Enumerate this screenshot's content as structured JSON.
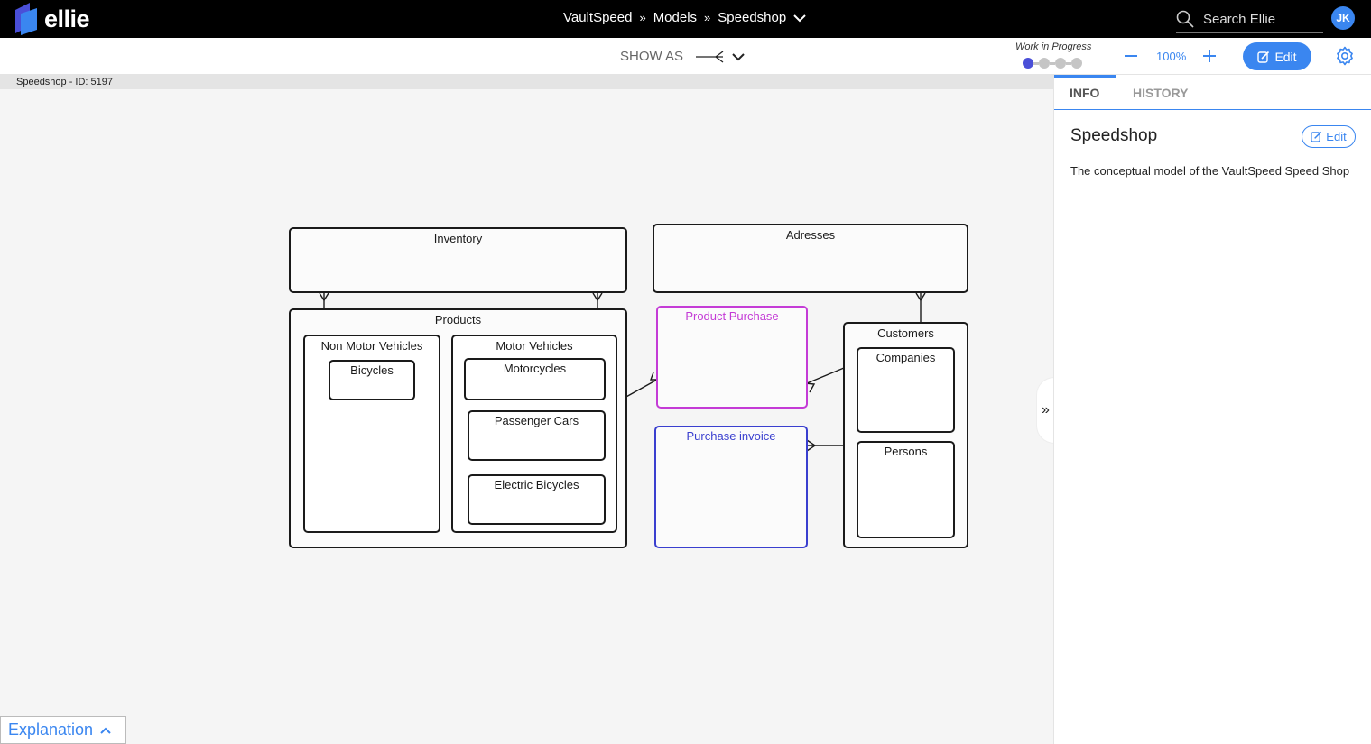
{
  "app": {
    "name": "ellie"
  },
  "breadcrumb": {
    "items": [
      "VaultSpeed",
      "Models",
      "Speedshop"
    ],
    "separator": "»"
  },
  "search": {
    "placeholder": "Search Ellie"
  },
  "user": {
    "initials": "JK"
  },
  "toolbar": {
    "show_as_label": "SHOW AS",
    "status_label": "Work in Progress",
    "status_step": 1,
    "status_total": 4,
    "zoom_level": "100%",
    "edit_label": "Edit"
  },
  "model_id_label": "Speedshop - ID: 5197",
  "diagram": {
    "entities": {
      "inventory": "Inventory",
      "adresses": "Adresses",
      "products": "Products",
      "non_motor_vehicles": "Non Motor Vehicles",
      "bicycles": "Bicycles",
      "motor_vehicles": "Motor Vehicles",
      "motorcycles": "Motorcycles",
      "passenger_cars": "Passenger Cars",
      "electric_bicycles": "Electric Bicycles",
      "product_purchase": "Product Purchase",
      "purchase_invoice": "Purchase invoice",
      "customers": "Customers",
      "companies": "Companies",
      "persons": "Persons"
    },
    "colors": {
      "product_purchase": "#c43bd6",
      "purchase_invoice": "#3a3fcf",
      "default": "#1a1a1a"
    }
  },
  "panel": {
    "tabs": [
      "INFO",
      "HISTORY"
    ],
    "active_tab": "INFO",
    "title": "Speedshop",
    "edit_label": "Edit",
    "description": "The conceptual model of the VaultSpeed Speed Shop",
    "collapse_label": "»"
  },
  "explanation": {
    "label": "Explanation"
  }
}
